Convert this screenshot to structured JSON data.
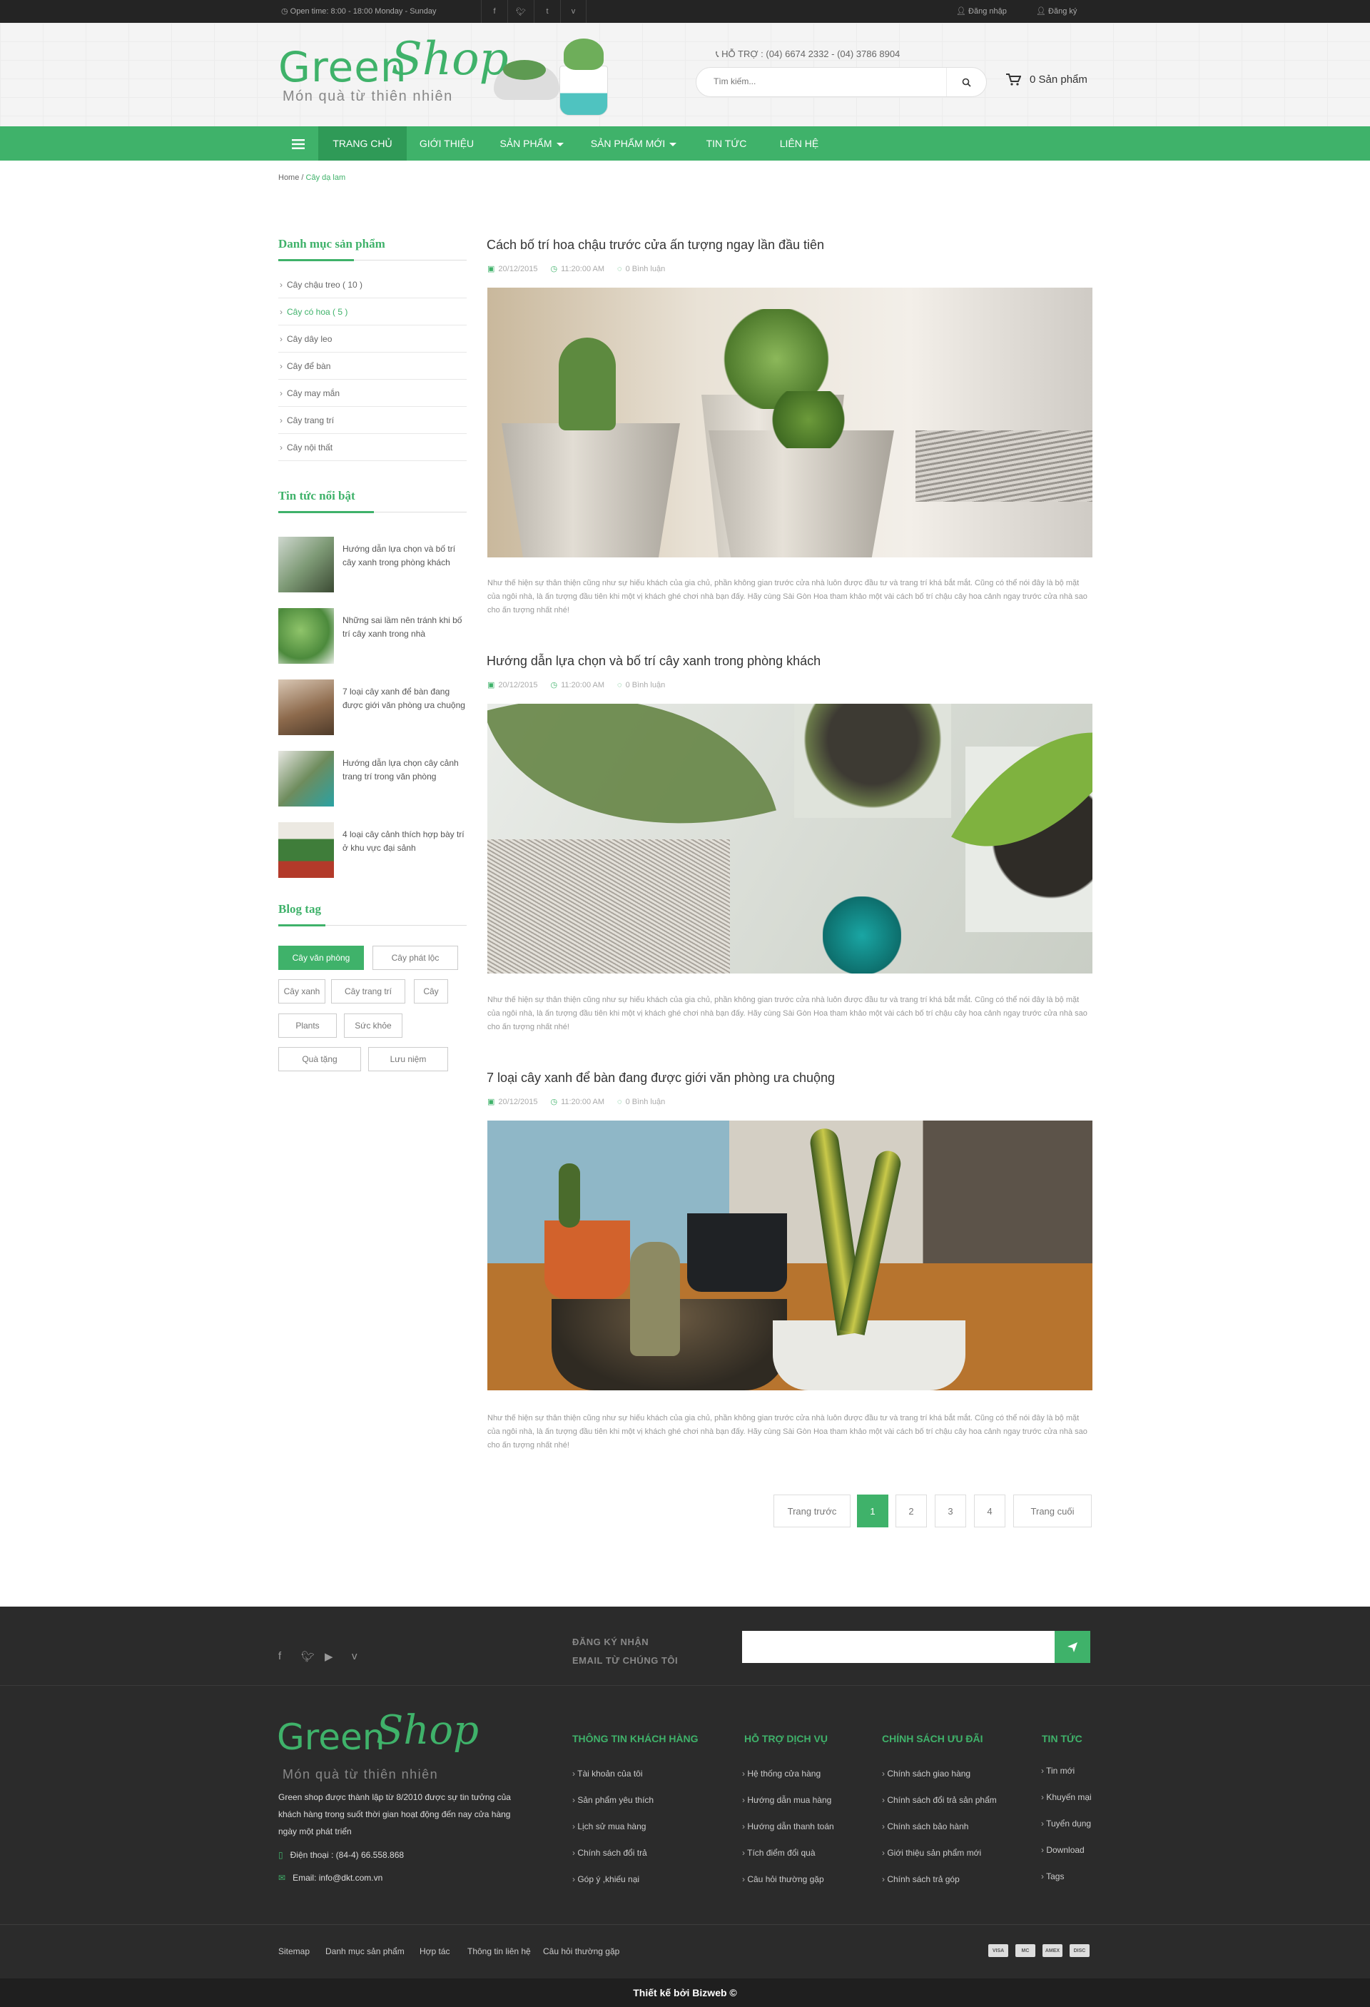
{
  "topbar": {
    "open_time": "Open time: 8:00 - 18:00   Monday - Sunday",
    "login": "Đăng nhập",
    "register": "Đăng ký"
  },
  "header": {
    "logo_green": "Green",
    "logo_shop": "Shop",
    "logo_tagline": "Món quà từ thiên nhiên",
    "hotline": "HỖ TRỢ :  (04) 6674 2332 - (04) 3786 8904",
    "search_placeholder": "Tìm kiếm...",
    "cart_label": "0 Sản phẩm"
  },
  "nav": {
    "items": [
      "TRANG CHỦ",
      "GIỚI THIỆU",
      "SẢN PHẨM",
      "SẢN PHẨM MỚI",
      "TIN TỨC",
      "LIÊN HỆ"
    ]
  },
  "breadcrumb": {
    "home": "Home",
    "sep": " / ",
    "current": "Cây dạ lam"
  },
  "sidebar": {
    "cat_title": "Danh mục sản phẩm",
    "categories": [
      "Cây chậu treo ( 10 )",
      "Cây có hoa ( 5 )",
      "Cây dây leo",
      "Cây để bàn",
      "Cây may mắn",
      "Cây trang trí",
      "Cây nội thất"
    ],
    "news_title": "Tin tức nổi bật",
    "news": [
      "Hướng dẫn lựa chọn và bố trí cây xanh trong phòng khách",
      "Những sai lầm nên tránh khi bố trí cây xanh trong nhà",
      "7 loại cây xanh để bàn đang được giới văn phòng ưa chuộng",
      "Hướng dẫn lựa chọn cây cảnh trang trí trong văn phòng",
      "4 loại cây cảnh thích hợp bày trí ở khu vực đại sảnh"
    ],
    "tag_title": "Blog tag",
    "tags": [
      "Cây văn phòng",
      "Cây phát lộc",
      "Cây xanh",
      "Cây trang trí",
      "Cây",
      "Plants",
      "Sức khỏe",
      "Quà tặng",
      "Lưu niệm"
    ]
  },
  "posts": [
    {
      "title": "Cách bố trí hoa chậu trước cửa ấn tượng ngay lần đầu tiên",
      "date": "20/12/2015",
      "time": "11:20:00 AM",
      "comments": "0 Bình luận"
    },
    {
      "title": "Hướng dẫn lựa chọn và bố trí cây xanh trong phòng khách",
      "date": "20/12/2015",
      "time": "11:20:00 AM",
      "comments": "0 Bình luận"
    },
    {
      "title": "7 loại cây xanh để bàn đang được giới văn phòng ưa chuộng",
      "date": "20/12/2015",
      "time": "11:20:00 AM",
      "comments": "0 Bình luận"
    }
  ],
  "excerpt": "Như thế hiện sự thân thiện cũng như sự hiếu khách của gia chủ, phần không gian trước cửa nhà luôn được đầu tư và trang trí khá bắt mắt. Cũng có thể nói đây là bộ mặt của ngôi nhà, là ấn tượng đầu tiên khi một vị khách ghé chơi nhà bạn đấy. Hãy cùng Sài Gòn Hoa tham khảo một vài cách bố trí chậu cây hoa cảnh ngay trước cửa nhà sao cho ấn tượng nhất nhé!",
  "pagination": {
    "prev": "Trang trước",
    "pages": [
      "1",
      "2",
      "3",
      "4"
    ],
    "last": "Trang cuối"
  },
  "footer": {
    "subscribe_line1": "ĐĂNG KÝ NHẬN",
    "subscribe_line2": "EMAIL TỪ CHÚNG TÔI",
    "desc": "Green shop được thành lập từ 8/2010 được sự tin tưởng của khách hàng trong suốt thời gian hoạt động đến nay cửa hàng ngày một phát triển",
    "phone": "Điện thoại : (84-4) 66.558.868",
    "email": "Email: info@dkt.com.vn",
    "col1_title": "THÔNG TIN KHÁCH HÀNG",
    "col1": [
      "Tài khoản của tôi",
      "Sản phẩm yêu thích",
      "Lịch sử mua hàng",
      "Chính sách đổi trả",
      "Góp ý ,khiếu nại"
    ],
    "col2_title": "HỖ TRỢ DỊCH VỤ",
    "col2": [
      "Hệ thống cửa hàng",
      "Hướng dẫn mua hàng",
      "Hướng dẫn thanh toán",
      "Tích điểm đổi quà",
      "Câu hỏi thường gặp"
    ],
    "col3_title": "CHÍNH SÁCH ƯU ĐÃI",
    "col3": [
      "Chính sách giao hàng",
      "Chính sách đổi trả sản phẩm",
      "Chính sách bảo hành",
      "Giới thiệu sản phẩm mới",
      "Chính sách trả góp"
    ],
    "col4_title": "TIN TỨC",
    "col4": [
      "Tin mới",
      "Khuyến mại",
      "Tuyển dụng",
      "Download",
      "Tags"
    ],
    "bottom_links": [
      "Sitemap",
      "Danh mục sản phẩm",
      "Hợp tác",
      "Thông tin liên hệ",
      "Câu hỏi thường gặp"
    ],
    "cards": [
      "VISA",
      "MC",
      "AMEX",
      "DISC"
    ],
    "copyright": "Thiết kế  bởi Bizweb ©"
  },
  "colors": {
    "accent": "#3fb26a",
    "dark": "#2b2b2b"
  }
}
